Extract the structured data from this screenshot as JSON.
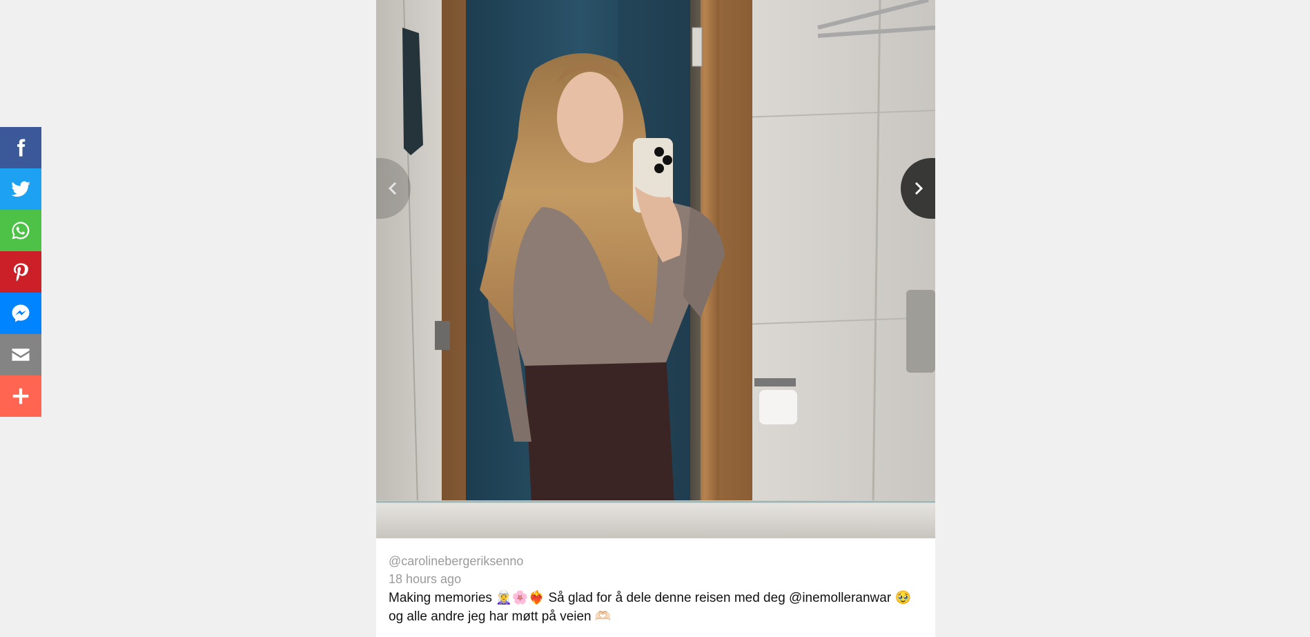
{
  "share": {
    "buttons": [
      {
        "name": "facebook",
        "color": "#3b5998",
        "icon": "facebook-icon"
      },
      {
        "name": "twitter",
        "color": "#1da1f2",
        "icon": "twitter-icon"
      },
      {
        "name": "whatsapp",
        "color": "#4dc247",
        "icon": "whatsapp-icon"
      },
      {
        "name": "pinterest",
        "color": "#cb2027",
        "icon": "pinterest-icon"
      },
      {
        "name": "messenger",
        "color": "#0084ff",
        "icon": "messenger-icon"
      },
      {
        "name": "email",
        "color": "#848484",
        "icon": "email-icon"
      },
      {
        "name": "more",
        "color": "#ff6550",
        "icon": "plus-icon"
      }
    ]
  },
  "post": {
    "handle": "@carolinebergeriksenno",
    "timestamp": "18 hours ago",
    "caption": "Making memories 🧝‍♀️🌸❤️‍🔥 Så glad for å dele denne reisen med deg @inemolleranwar 🥹 og alle andre jeg har møtt på veien 🫶🏻"
  }
}
